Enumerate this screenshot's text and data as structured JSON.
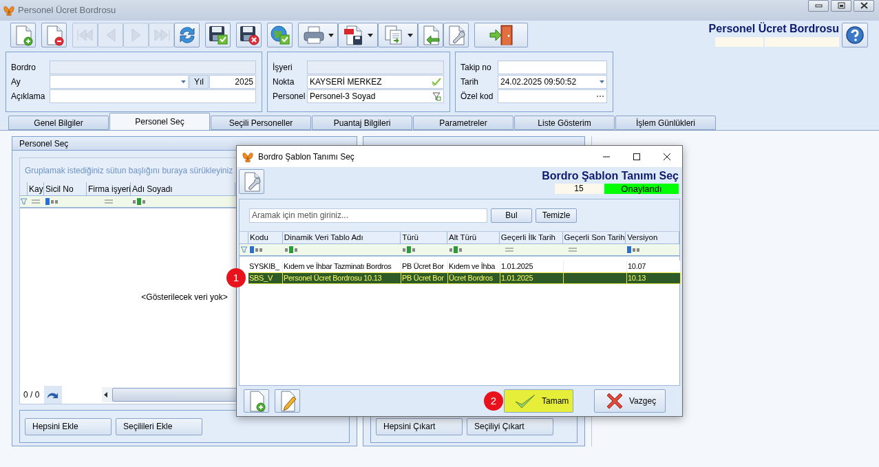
{
  "window": {
    "title": "Personel Ücret Bordrosu"
  },
  "toolbar": [
    {
      "buttons": [
        {
          "kind": "new",
          "disabled": false
        }
      ]
    },
    {
      "buttons": [
        {
          "kind": "delete",
          "disabled": false
        }
      ]
    },
    {
      "buttons": [
        {
          "kind": "first",
          "disabled": true
        },
        {
          "kind": "prev",
          "disabled": true
        },
        {
          "kind": "next",
          "disabled": true
        },
        {
          "kind": "last",
          "disabled": true
        },
        {
          "kind": "refresh",
          "disabled": false
        }
      ]
    },
    {
      "buttons": [
        {
          "kind": "save",
          "disabled": false
        }
      ]
    },
    {
      "buttons": [
        {
          "kind": "save-cancel",
          "disabled": false
        }
      ]
    },
    {
      "buttons": [
        {
          "kind": "globe",
          "disabled": false
        }
      ]
    },
    {
      "buttons": [
        {
          "kind": "print",
          "disabled": false,
          "dropdown": true
        },
        {
          "kind": "pdf",
          "disabled": false,
          "dropdown": true
        },
        {
          "kind": "copy",
          "disabled": false,
          "dropdown": true
        },
        {
          "kind": "import",
          "disabled": false
        },
        {
          "kind": "tools",
          "disabled": false
        }
      ]
    },
    {
      "buttons": [
        {
          "kind": "exit",
          "disabled": false
        }
      ]
    }
  ],
  "header": {
    "title": "Personel Ücret Bordrosu"
  },
  "form_groups": [
    {
      "fields": [
        {
          "label": "Bordro",
          "kind": "readonly"
        },
        {
          "label": "Ay",
          "kind": "dropdown",
          "extra_label": "Yıl",
          "extra_value": "2025"
        },
        {
          "label": "Açıklama",
          "kind": "text"
        }
      ]
    },
    {
      "fields": [
        {
          "label": "İşyeri",
          "kind": "readonly"
        },
        {
          "label": "Nokta",
          "kind": "check",
          "value": "KAYSERİ MERKEZ"
        },
        {
          "label": "Personel",
          "kind": "lookup",
          "value": "Personel-3 Soyad"
        }
      ]
    },
    {
      "fields": [
        {
          "label": "Takip no",
          "kind": "text"
        },
        {
          "label": "Tarih",
          "kind": "dropdown",
          "value": "24.02.2025 09:50:52"
        },
        {
          "label": "Özel kod",
          "kind": "ellipsis"
        }
      ]
    }
  ],
  "tabs": [
    {
      "label": "Genel Bilgiler",
      "selected": false
    },
    {
      "label": "Personel Seç",
      "selected": true
    },
    {
      "label": "Seçili Personeller",
      "selected": false
    },
    {
      "label": "Puantaj Bilgileri",
      "selected": false
    },
    {
      "label": "Parametreler",
      "selected": false
    },
    {
      "label": "Liste Gösterim",
      "selected": false
    },
    {
      "label": "İşlem Günlükleri",
      "selected": false
    }
  ],
  "left_panel": {
    "title": "Personel Seç",
    "group_hint": "Gruplamak istediğiniz sütun başlığını buraya sürükleyiniz",
    "columns": [
      {
        "label": "Kay",
        "kind": "equals"
      },
      {
        "label": "Sicil No",
        "kind": "text"
      },
      {
        "label": "Firma işyeri",
        "kind": "equals"
      },
      {
        "label": "Adı Soyadı",
        "kind": "contains"
      }
    ],
    "empty_text": "<Gösterilecek veri yok>",
    "counter": "0 / 0",
    "buttons": [
      "Hepsini Ekle",
      "Seçilileri Ekle"
    ]
  },
  "right_panel": {
    "buttons": [
      "Hepsini Çıkart",
      "Seçiliyi Çıkart"
    ]
  },
  "dialog": {
    "title": "Bordro Şablon Tanımı Seç",
    "header_title": "Bordro Şablon Tanımı Seç",
    "record_no": "15",
    "status": {
      "text": "Onaylandı",
      "color": "#00ff00"
    },
    "search": {
      "placeholder": "Aramak için metin giriniz..."
    },
    "search_buttons": [
      "Bul",
      "Temizle"
    ],
    "columns": [
      {
        "label": "Kodu",
        "kind": "text"
      },
      {
        "label": "Dinamik Veri Tablo Adı",
        "kind": "contains"
      },
      {
        "label": "Türü",
        "kind": "contains"
      },
      {
        "label": "Alt Türü",
        "kind": "contains"
      },
      {
        "label": "Geçerli İlk Tarih",
        "kind": "equals"
      },
      {
        "label": "Geçerli Son Tarih",
        "kind": "equals"
      },
      {
        "label": "Versiyon",
        "kind": "text"
      }
    ],
    "rows": [
      {
        "cells": [
          "SYSKIB_",
          "Kıdem ve İhbar Tazminatı Bordros",
          "PB Ücret Bor",
          "Kıdem ve İhba",
          "1.01.2025",
          "",
          "10.07"
        ],
        "selected": false
      },
      {
        "cells": [
          "SBS_V",
          "Personel Ücret Bordrosu 10.13",
          "PB Ücret Bor",
          "Ücret Bordros",
          "1.01.2025",
          "",
          "10.13"
        ],
        "selected": true,
        "callout": "1"
      }
    ],
    "buttons": [
      {
        "label": "Tamam",
        "kind": "ok",
        "highlighted": true,
        "callout": "2"
      },
      {
        "label": "Vazgeç",
        "kind": "cancel",
        "highlighted": false
      }
    ]
  }
}
